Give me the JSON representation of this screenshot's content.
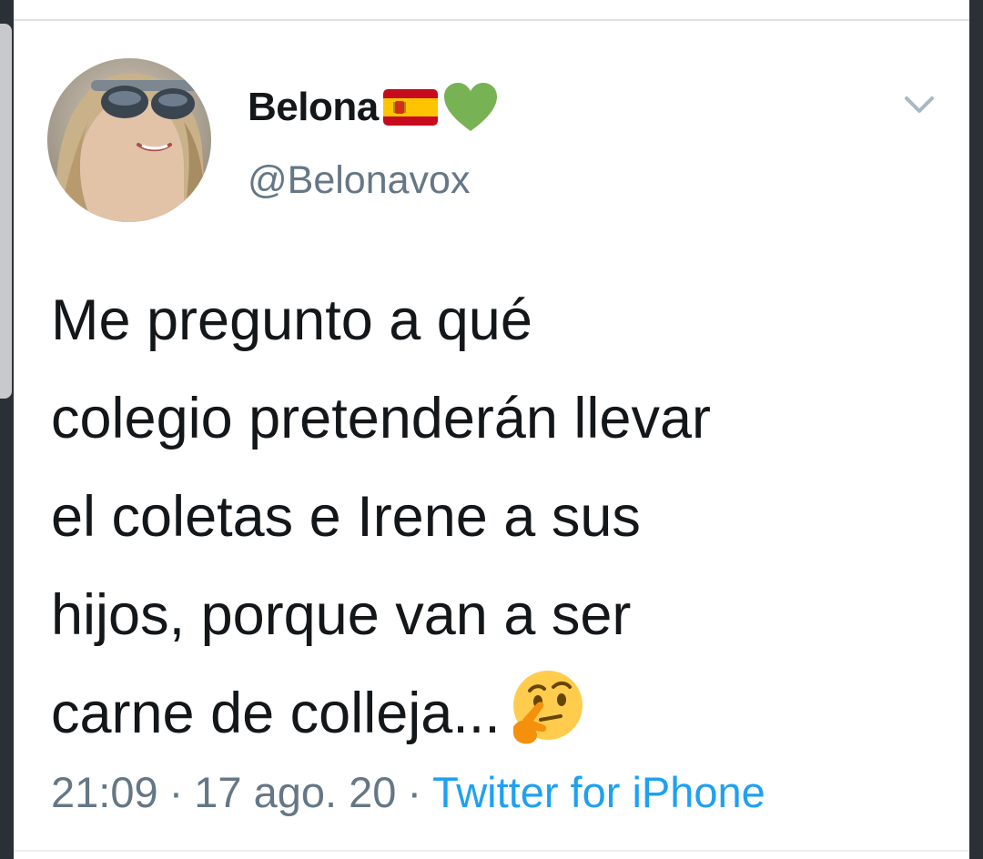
{
  "tweet": {
    "author": {
      "display_name": "Belona",
      "handle": "@Belonavox",
      "name_emoji": [
        "spain-flag",
        "green-heart"
      ]
    },
    "text_lines": [
      "Me pregunto a qué",
      "colegio pretenderán llevar",
      "el coletas e Irene a sus",
      "hijos, porque van a ser",
      "carne de colleja..."
    ],
    "trailing_emoji": "thinking-face",
    "time": "21:09",
    "date": "17 ago. 20",
    "source": "Twitter for iPhone",
    "separator": "·"
  },
  "colors": {
    "text": "#14171a",
    "secondary": "#657786",
    "link": "#1da1f2",
    "heart": "#77b255"
  }
}
